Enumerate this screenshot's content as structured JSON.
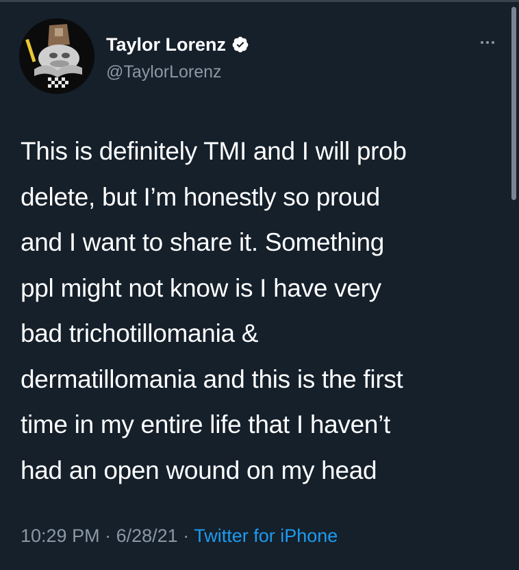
{
  "tweet": {
    "author": {
      "display_name": "Taylor Lorenz",
      "handle": "@TaylorLorenz",
      "verified": true,
      "avatar_icon": "avatar-image"
    },
    "more_icon": "more-options-icon",
    "text_lines": [
      "This is definitely TMI and I will prob",
      "delete, but I’m honestly so proud",
      "and I want to share it. Something",
      "ppl might not know is I have very",
      "bad trichotillomania &",
      "dermatillomania and this is the first",
      "time in my entire life that I haven’t",
      "had an open wound on my head"
    ],
    "time": "10:29 PM",
    "separator": "·",
    "date": "6/28/21",
    "source": "Twitter for iPhone"
  },
  "colors": {
    "background": "#15202b",
    "text": "#ffffff",
    "muted": "#8b98a5",
    "link": "#1d9bf0",
    "verified_badge": "#ffffff"
  }
}
